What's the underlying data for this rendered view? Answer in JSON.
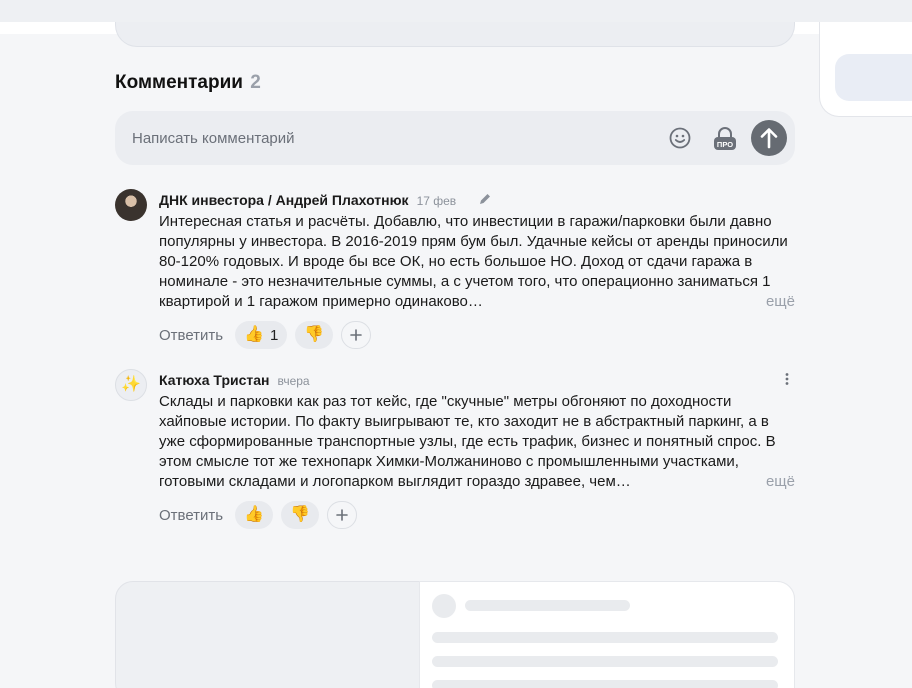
{
  "comments_section": {
    "title": "Комментарии",
    "count": "2",
    "input_placeholder": "Написать комментарий"
  },
  "comments": [
    {
      "author": "ДНК инвестора / Андрей Плахотнюк",
      "date": "17 фев",
      "text": "Интересная статья и расчёты. Добавлю, что инвестиции в гаражи/парковки были давно популярны у инвестора. В 2016-2019 прям бум был. Удачные кейсы от аренды приносили 80-120% годовых. И вроде бы все ОК, но есть большое НО. Доход от сдачи гаража в номинале - это незначительные суммы, а с учетом того, что операционно заниматься 1 квартирой и 1 гаражом примерно одинаково",
      "ellipsis": "…",
      "more_label": "ещё",
      "reply_label": "Ответить",
      "likes": "1",
      "dislikes": ""
    },
    {
      "author": "Катюха Тристан",
      "date": "вчера",
      "avatar_emoji": "✨",
      "text": "Склады и парковки как раз тот кейс, где \"скучные\" метры обгоняют по доходности хайповые истории. По факту выигрывают те, кто заходит не в абстрактный паркинг, а в уже сформированные транспортные узлы, где есть трафик, бизнес и понятный спрос. В этом смысле тот же технопарк Химки-Молжаниново с промышленными участками, готовыми складами и логопарком выглядит гораздо здравее, чем",
      "ellipsis": "…",
      "more_label": "ещё",
      "reply_label": "Ответить",
      "likes": "",
      "dislikes": ""
    }
  ],
  "icons": {
    "like": "👍",
    "dislike": "👎",
    "add_reaction": "plus-icon",
    "emoji_picker": "smile-icon",
    "pro": "pro-lock-icon",
    "send": "arrow-up-icon",
    "edit": "pencil-icon",
    "more": "kebab-icon"
  },
  "colors": {
    "page_bg": "#f5f6f8",
    "input_bg": "#ebedf1",
    "reaction_bg": "#e8eaee",
    "muted_text": "#9aa0aa",
    "send_button": "#666b72"
  }
}
